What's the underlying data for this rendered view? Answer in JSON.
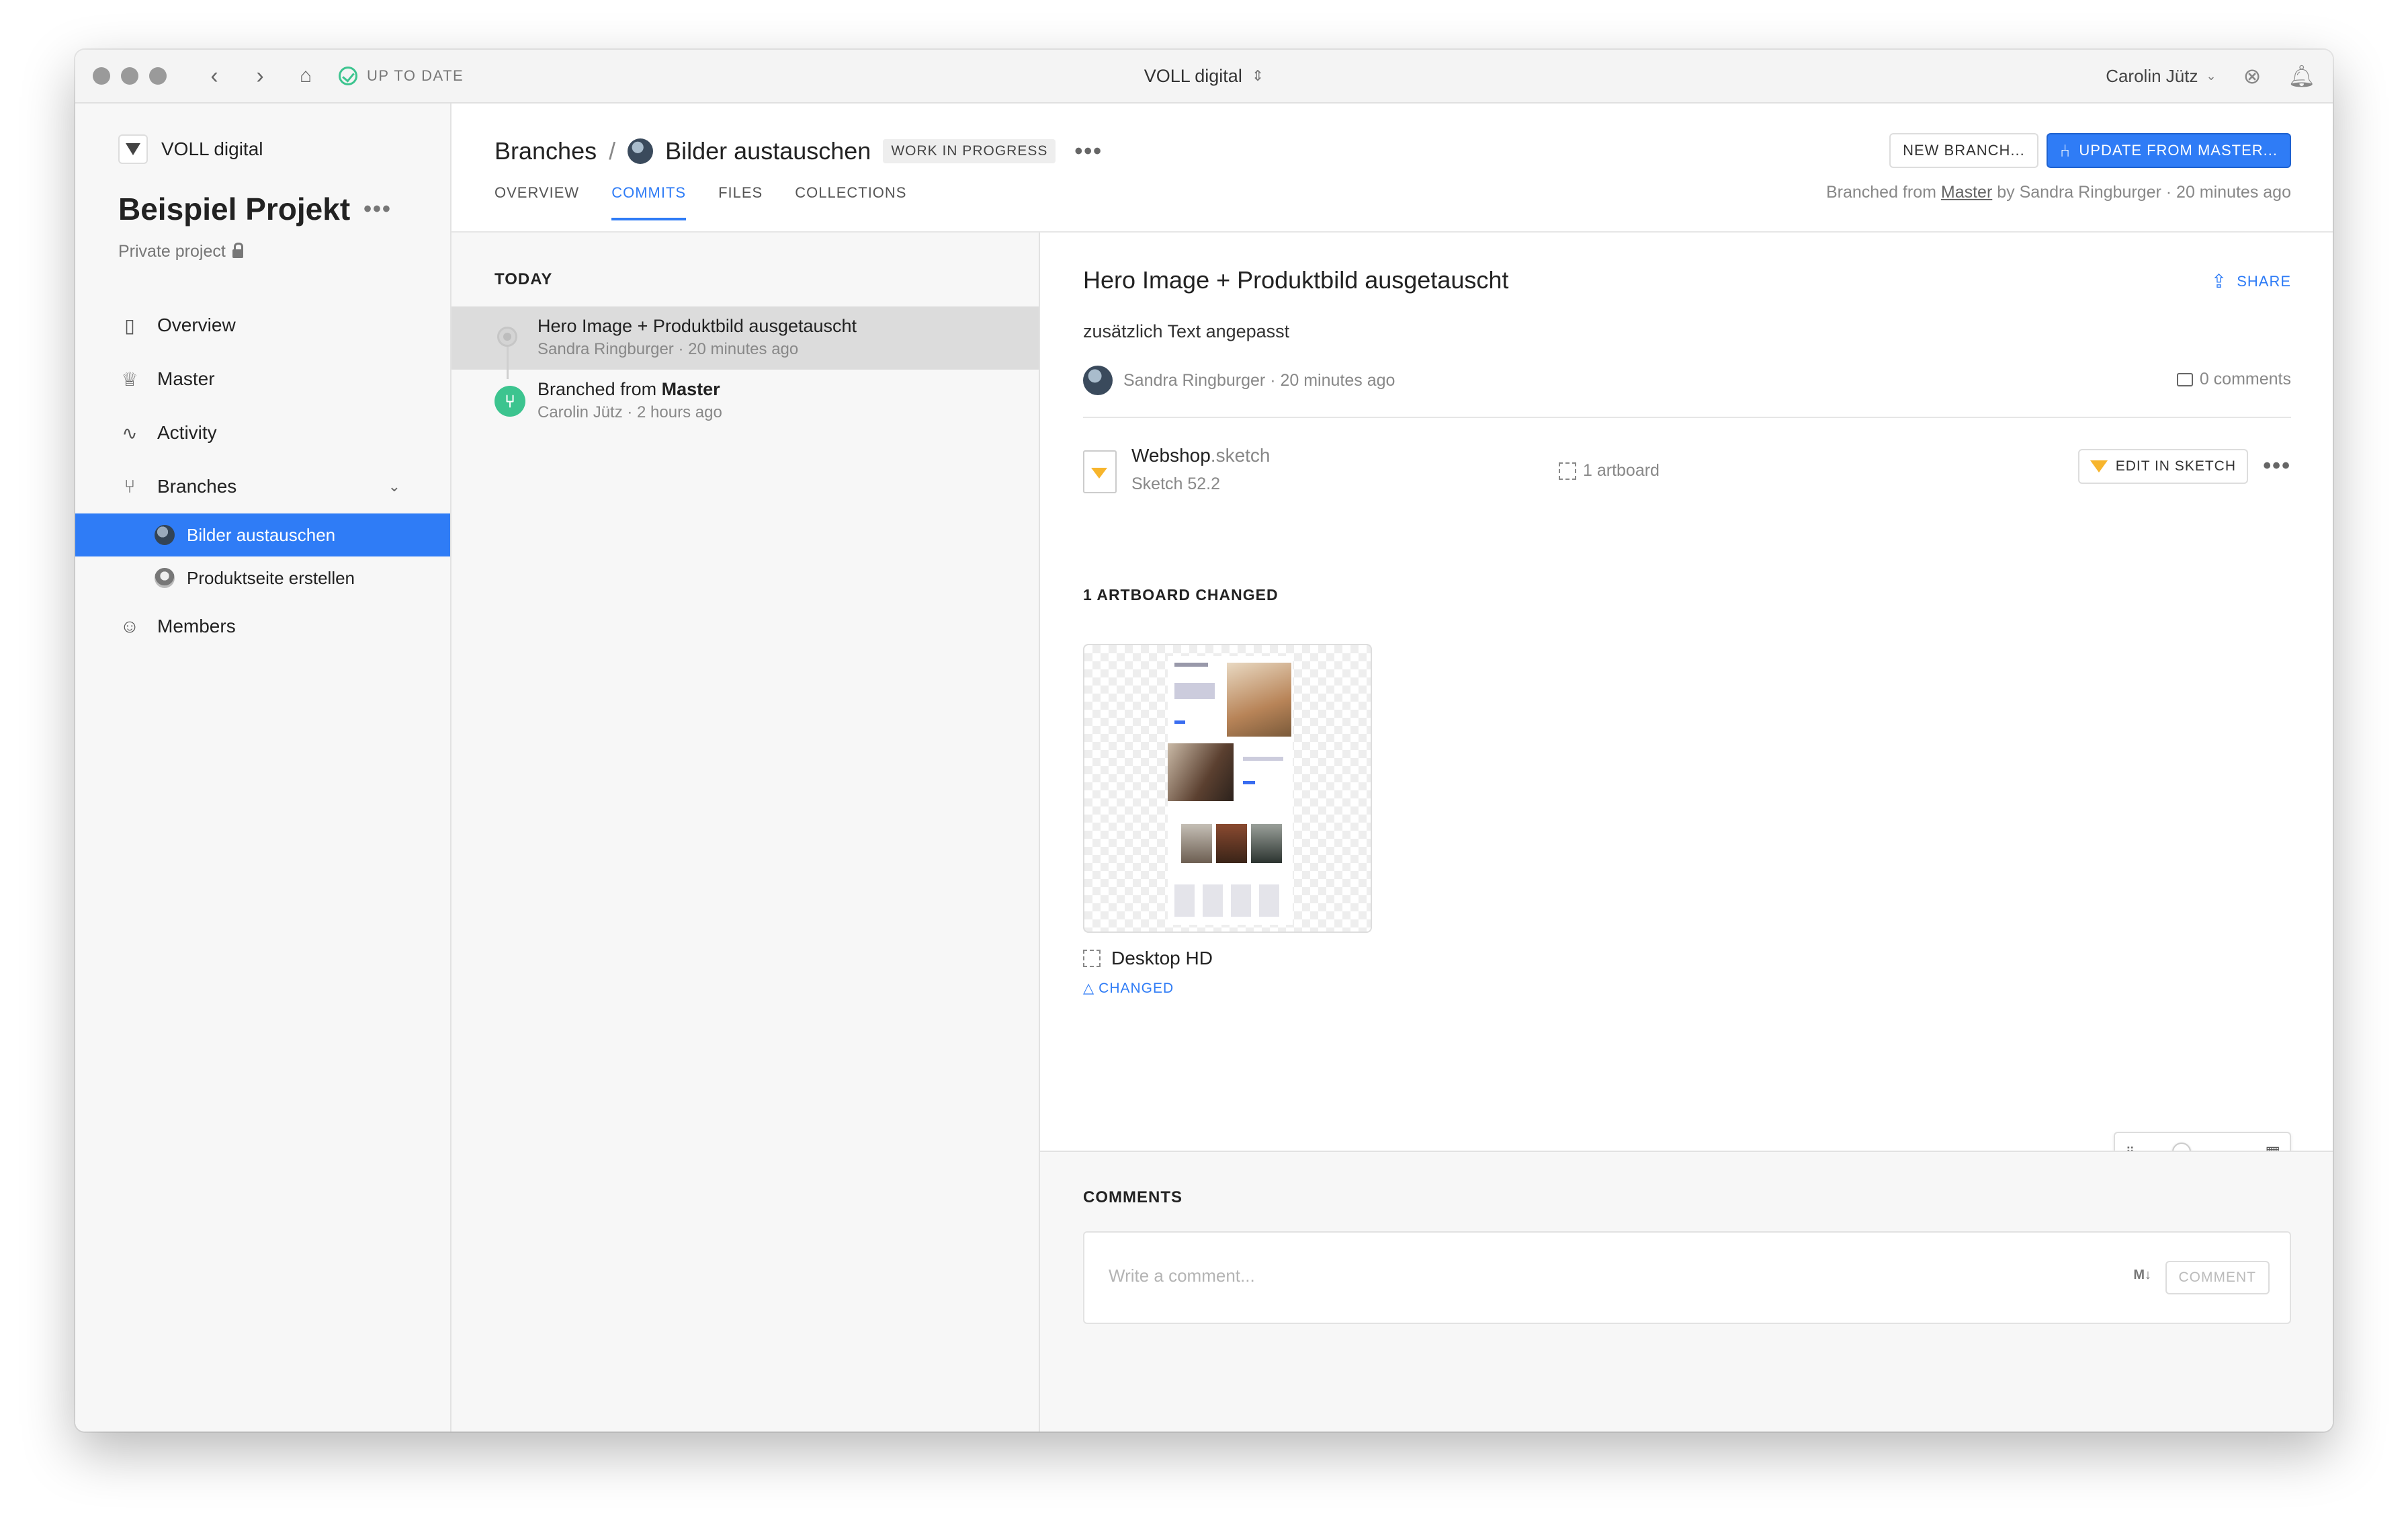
{
  "titlebar": {
    "status": "UP TO DATE",
    "workspace": "VOLL digital",
    "user": "Carolin Jütz"
  },
  "sidebar": {
    "workspace": "VOLL digital",
    "project_title": "Beispiel Projekt",
    "project_sub": "Private project",
    "items": [
      {
        "label": "Overview",
        "icon": "document-icon"
      },
      {
        "label": "Master",
        "icon": "crown-icon"
      },
      {
        "label": "Activity",
        "icon": "activity-icon"
      },
      {
        "label": "Branches",
        "icon": "branch-icon"
      },
      {
        "label": "Members",
        "icon": "person-icon"
      }
    ],
    "branches": [
      {
        "label": "Bilder austauschen",
        "active": true
      },
      {
        "label": "Produktseite erstellen",
        "active": false
      }
    ]
  },
  "header": {
    "crumb_root": "Branches",
    "crumb_sep": "/",
    "branch_name": "Bilder austauschen",
    "badge": "WORK IN PROGRESS",
    "tabs": [
      "OVERVIEW",
      "COMMITS",
      "FILES",
      "COLLECTIONS"
    ],
    "active_tab": "COMMITS",
    "new_branch": "NEW BRANCH...",
    "update_master": "UPDATE FROM MASTER...",
    "branched_prefix": "Branched from",
    "branched_link": "Master",
    "branched_suffix": "by Sandra Ringburger · 20 minutes ago"
  },
  "commits": {
    "group": "TODAY",
    "items": [
      {
        "title": "Hero Image + Produktbild ausgetauscht",
        "meta": "Sandra Ringburger · 20 minutes ago"
      },
      {
        "title_prefix": "Branched from",
        "title_bold": "Master",
        "meta": "Carolin Jütz · 2 hours ago"
      }
    ]
  },
  "detail": {
    "title": "Hero Image + Produktbild ausgetauscht",
    "share": "SHARE",
    "description": "zusätzlich Text angepasst",
    "author_meta": "Sandra Ringburger · 20 minutes ago",
    "comments_count": "0 comments",
    "file_name": "Webshop",
    "file_ext": ".sketch",
    "file_version": "Sketch 52.2",
    "artboard_count": "1 artboard",
    "edit_button": "EDIT IN SKETCH",
    "changed_heading": "1 ARTBOARD CHANGED",
    "artboard_name": "Desktop HD",
    "artboard_status": "CHANGED",
    "zoom_level": 0.3
  },
  "comments": {
    "heading": "COMMENTS",
    "placeholder": "Write a comment...",
    "markdown": "M↓",
    "button": "COMMENT"
  },
  "colors": {
    "accent": "#2f7cf6",
    "success": "#3cc48f",
    "sketch": "#f7b52c"
  }
}
